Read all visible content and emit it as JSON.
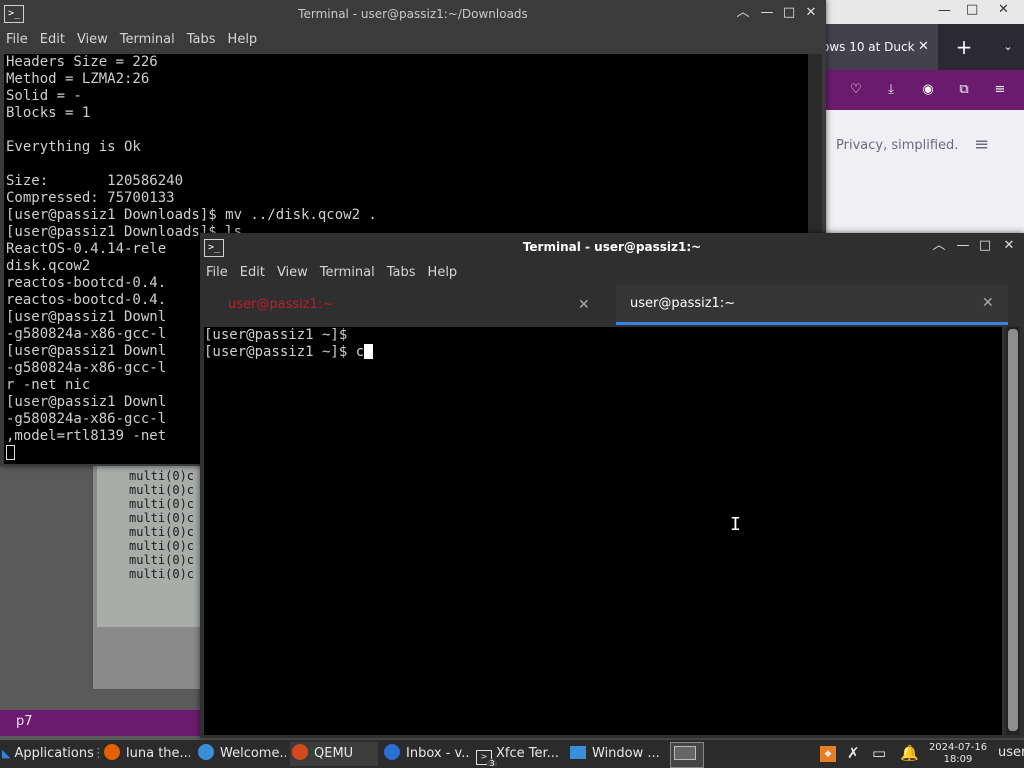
{
  "firefox": {
    "tab_title": "ows 10 at Duck",
    "tab_close": "✕",
    "new_tab": "+",
    "list_tabs": "⌄",
    "page_text": "Privacy, simplified.",
    "menu_icon": "≡"
  },
  "qemu": {
    "lines": [
      "multi(0)c",
      "multi(0)c",
      "multi(0)c",
      "multi(0)c",
      "multi(0)c",
      "multi(0)c",
      "multi(0)c",
      "multi(0)c"
    ]
  },
  "win1": {
    "title": "Terminal - user@passiz1:~/Downloads",
    "menu": [
      "File",
      "Edit",
      "View",
      "Terminal",
      "Tabs",
      "Help"
    ],
    "lines": [
      "Headers Size = 226",
      "Method = LZMA2:26",
      "Solid = -",
      "Blocks = 1",
      "",
      "Everything is Ok",
      "",
      "Size:       120586240",
      "Compressed: 75700133",
      "[user@passiz1 Downloads]$ mv ../disk.qcow2 .",
      "[user@passiz1 Downloads]$ ls",
      "ReactOS-0.4.14-rele",
      "disk.qcow2",
      "reactos-bootcd-0.4.",
      "reactos-bootcd-0.4.",
      "[user@passiz1 Downl",
      "-g580824a-x86-gcc-l",
      "[user@passiz1 Downl",
      "-g580824a-x86-gcc-l",
      "r -net nic",
      "[user@passiz1 Downl",
      "-g580824a-x86-gcc-l",
      ",model=rtl8139 -net"
    ]
  },
  "win2": {
    "title": "Terminal - user@passiz1:~",
    "menu": [
      "File",
      "Edit",
      "View",
      "Terminal",
      "Tabs",
      "Help"
    ],
    "tabs": [
      {
        "label": "user@passiz1:~",
        "close": "✕"
      },
      {
        "label": "user@passiz1:~",
        "close": "✕"
      }
    ],
    "lines": [
      "[user@passiz1 ~]$",
      "[user@passiz1 ~]$ c"
    ]
  },
  "p7_label": "p7",
  "taskbar": {
    "applications": "Applications",
    "items": [
      "luna the...",
      "Welcome...",
      "QEMU",
      "Inbox - v...",
      "Xfce Ter...",
      "Window ..."
    ],
    "xfce_badge": "3",
    "clock_date": "2024-07-16",
    "clock_time": "18:09",
    "user": "user"
  },
  "colors": {
    "firefox_purple": "#6b1b6e",
    "active_tab_underline": "#3584e4",
    "inactive_tab_text": "#c01c28"
  }
}
